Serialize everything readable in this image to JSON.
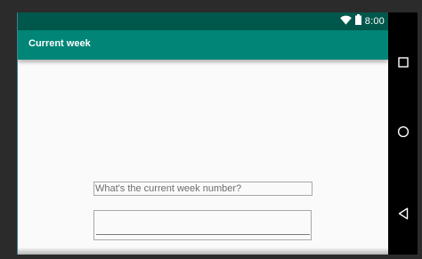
{
  "status_bar": {
    "time": "8:00",
    "icons": [
      "wifi-icon",
      "battery-icon"
    ],
    "background": "#00574b"
  },
  "app_bar": {
    "title": "Current week",
    "background": "#008577"
  },
  "form": {
    "question_label": "What's the current week number?",
    "week_input_value": "",
    "week_input_placeholder": ""
  },
  "nav_bar": {
    "buttons": [
      "recents-icon",
      "home-icon",
      "back-icon"
    ],
    "background": "#000000"
  }
}
